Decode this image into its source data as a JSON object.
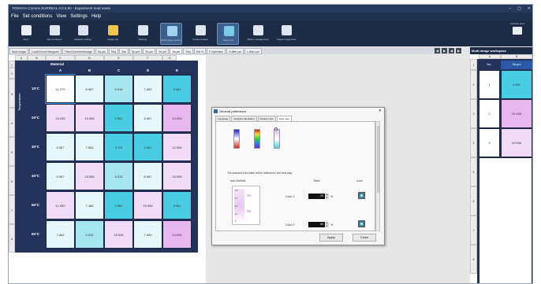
{
  "window": {
    "title": "TOSHIYA Comms SURREAL 0.0.5.90 - Experiment mod name",
    "controls": [
      "–",
      "▢",
      "✕"
    ]
  },
  "menu": [
    "File",
    "Set conditions",
    "View",
    "Settings",
    "Help"
  ],
  "ribbon": {
    "buttons": [
      {
        "label": "Open",
        "icon": "folder-icon",
        "color": "#e9eef6"
      },
      {
        "label": "Set conditions",
        "icon": "sliders-icon",
        "color": "#dfe6f0"
      },
      {
        "label": "Measure setting",
        "icon": "gauge-icon",
        "color": "#d9e2ee"
      },
      {
        "label": "Image info",
        "icon": "image-icon",
        "color": "#f0c64a"
      },
      {
        "label": "Filtering",
        "icon": "filter-icon",
        "color": "#dfe6f0"
      },
      {
        "label": "Multi-image workspace",
        "icon": "grid-icon",
        "color": "#9fd3f0"
      },
      {
        "label": "Create surface",
        "icon": "layers-icon",
        "color": "#dfe6f0"
      },
      {
        "label": "Heat map",
        "icon": "heatmap-icon",
        "color": "#7fc9e8"
      },
      {
        "label": "Tables management",
        "icon": "table-icon",
        "color": "#dfe6f0"
      },
      {
        "label": "Output image data",
        "icon": "export-icon",
        "color": "#dfe6f0"
      }
    ],
    "right_label": "Analysis area"
  },
  "tabs": [
    "Main image",
    "Load/Curve/Histogram",
    "Filter/Correct/edimage",
    "Sq µm",
    "Sdq",
    "Ssk",
    "Sp µm",
    "Sv µm",
    "Sz µm",
    "Sa µm",
    "Sdq",
    "Sdr %",
    "F.Operation",
    "S-filter µm",
    "L-filter µm"
  ],
  "active_tab_index": 9,
  "nav_buttons": [
    "◀",
    "▶",
    "◀",
    "▶"
  ],
  "sheet": {
    "col_headers": [
      "A",
      "B",
      "C",
      "D",
      "E",
      "F",
      "G"
    ],
    "row_headers": [
      "1",
      "2",
      "3",
      "4",
      "5",
      "6",
      "7",
      "8"
    ],
    "material_label": "Material",
    "material_letters": [
      "A",
      "B",
      "C",
      "D",
      "E"
    ],
    "vertical_label": "Temperature",
    "rows": [
      {
        "label": "10°C",
        "cells": [
          {
            "v": "11.279",
            "h": 6
          },
          {
            "v": "8.987",
            "h": 3
          },
          {
            "v": "5.515",
            "h": 2
          },
          {
            "v": "7.683",
            "h": 3
          },
          {
            "v": "3.961",
            "h": 1
          }
        ]
      },
      {
        "label": "20°C",
        "cells": [
          {
            "v": "16.035",
            "h": 4
          },
          {
            "v": "15.556",
            "h": 4
          },
          {
            "v": "3.961",
            "h": 1
          },
          {
            "v": "8.967",
            "h": 3
          },
          {
            "v": "24.006",
            "h": 5
          }
        ]
      },
      {
        "label": "30°C",
        "cells": [
          {
            "v": "6.967",
            "h": 3
          },
          {
            "v": "7.683",
            "h": 3
          },
          {
            "v": "4.115",
            "h": 1
          },
          {
            "v": "3.961",
            "h": 1
          },
          {
            "v": "12.956",
            "h": 4
          }
        ]
      },
      {
        "label": "40°C",
        "cells": [
          {
            "v": "6.967",
            "h": 3
          },
          {
            "v": "15.556",
            "h": 4
          },
          {
            "v": "5.515",
            "h": 2
          },
          {
            "v": "6.967",
            "h": 3
          },
          {
            "v": "15.956",
            "h": 4
          }
        ]
      },
      {
        "label": "50°C",
        "cells": [
          {
            "v": "11.950",
            "h": 4
          },
          {
            "v": "7.468",
            "h": 3
          },
          {
            "v": "3.961",
            "h": 1
          },
          {
            "v": "15.556",
            "h": 4
          },
          {
            "v": "3.961",
            "h": 1
          }
        ]
      },
      {
        "label": "60°C",
        "cells": [
          {
            "v": "7.683",
            "h": 3
          },
          {
            "v": "5.515",
            "h": 2
          },
          {
            "v": "15.556",
            "h": 4
          },
          {
            "v": "7.683",
            "h": 3
          },
          {
            "v": "24.006",
            "h": 5
          }
        ]
      }
    ]
  },
  "dialog": {
    "title": "General preference",
    "tabs": [
      "Language",
      "Analysis calculation",
      "Display color",
      "Heat map"
    ],
    "active_tab_index": 3,
    "colorbars": [
      {
        "gradient": "linear-gradient(to bottom, #1f1fe0, #ffffff, #e0201f)"
      },
      {
        "gradient": "linear-gradient(to bottom, #e01f1f, #f0e02a, #2ed23a, #2a7de8, #6a2ad2)"
      },
      {
        "gradient": "linear-gradient(to bottom, #e2b8f0, #ffffff, #4fd0e4)"
      }
    ],
    "note": "The selected color table will be reflected in the heat map.",
    "col_user_defined": "User Defined",
    "col_ratio": "Ratio",
    "col_color": "Color",
    "list_ticks": [
      "100",
      "75",
      "50",
      "25",
      "0"
    ],
    "color_rows": [
      {
        "label": "Color 1",
        "ratio": "20",
        "unit": "%"
      },
      {
        "label": "Color 2",
        "ratio": "60",
        "unit": "%"
      }
    ],
    "apply": "Apply",
    "close": "Close"
  },
  "right_pane": {
    "title": "Multi-image workspace",
    "col_headers": [
      "A",
      "B"
    ],
    "headers": [
      "No.",
      "Sa µm"
    ],
    "row_headers": [
      "1",
      "2",
      "3",
      "4",
      "5",
      "6",
      "7",
      "8"
    ],
    "rows": [
      {
        "no": "1",
        "value": "3.961",
        "color": "#49cde2"
      },
      {
        "no": "2",
        "value": "24.006",
        "color": "#e8b7f0"
      },
      {
        "no": "3",
        "value": "15.556",
        "color": "#f1dbf6"
      }
    ]
  }
}
